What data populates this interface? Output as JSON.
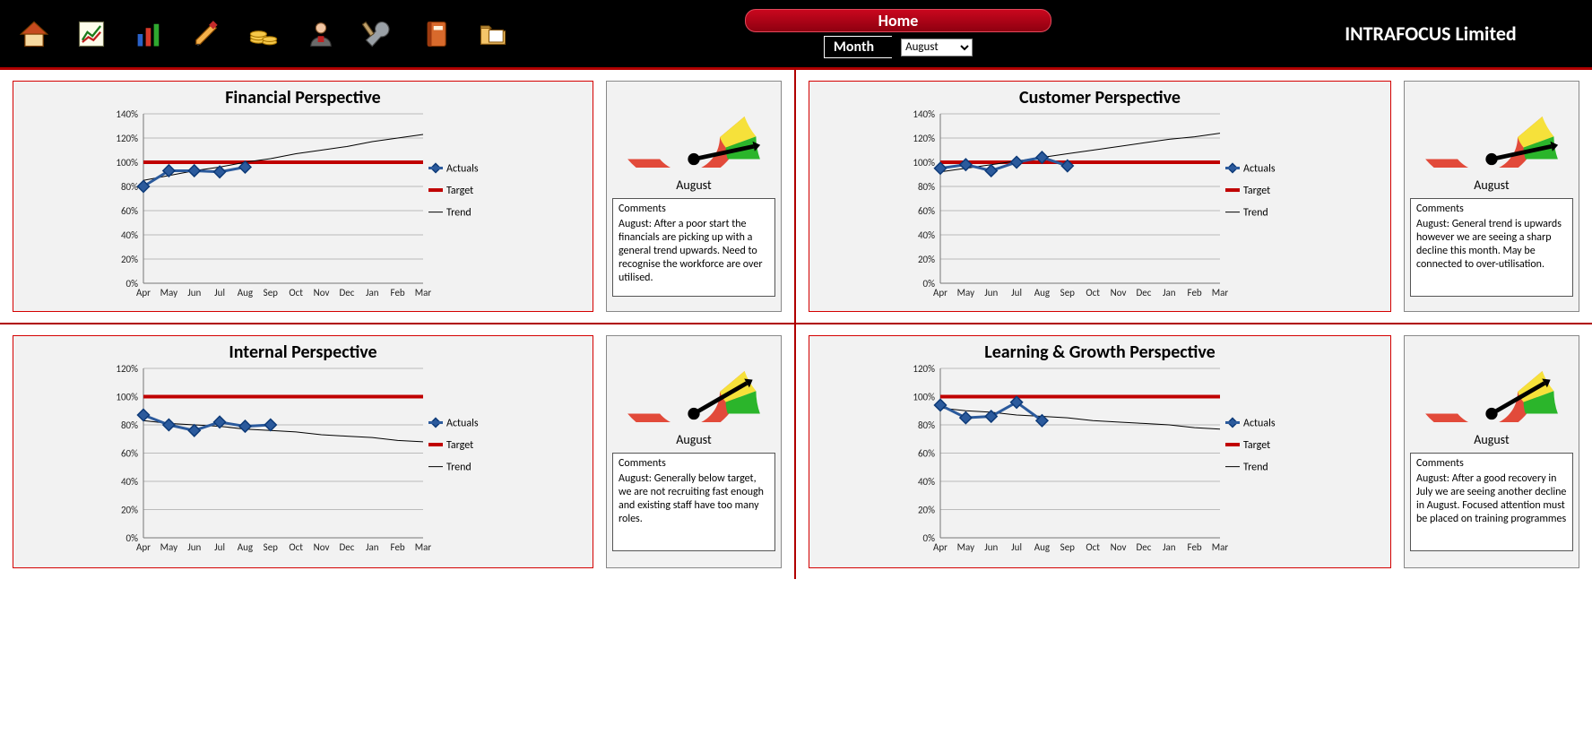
{
  "brand": "INTRAFOCUS Limited",
  "home_label": "Home",
  "month_label": "Month",
  "month_selected": "August",
  "comments_heading": "Comments",
  "legend": {
    "actuals": "Actuals",
    "target": "Target",
    "trend": "Trend"
  },
  "toolbar_icons": [
    "home",
    "report",
    "bar-chart",
    "edit",
    "finance",
    "user",
    "tools",
    "notebook",
    "folder"
  ],
  "panels": [
    {
      "id": "financial",
      "title": "Financial Perspective",
      "gauge_month": "August",
      "gauge_zone": "green",
      "comment": "August: After a poor start the financials are picking up with a general trend upwards.  Need to recognise the workforce are over utilised."
    },
    {
      "id": "customer",
      "title": "Customer Perspective",
      "gauge_month": "August",
      "gauge_zone": "green",
      "comment": "August: General trend is upwards however we are seeing a sharp decline this month.  May be connected to over-utilisation."
    },
    {
      "id": "internal",
      "title": "Internal Perspective",
      "gauge_month": "August",
      "gauge_zone": "yellow",
      "comment": "August: Generally below target, we are not recruiting fast enough and existing staff have too many roles."
    },
    {
      "id": "learning",
      "title": "Learning & Growth Perspective",
      "gauge_month": "August",
      "gauge_zone": "yellow",
      "comment": "August: After a good recovery in July we are seeing another decline in August.  Focused attention must be placed on training programmes"
    }
  ],
  "chart_data": [
    {
      "panel": "financial",
      "type": "line",
      "title": "Financial Perspective",
      "ylabel": "",
      "xlabel": "",
      "categories": [
        "Apr",
        "May",
        "Jun",
        "Jul",
        "Aug",
        "Sep",
        "Oct",
        "Nov",
        "Dec",
        "Jan",
        "Feb",
        "Mar"
      ],
      "ylim": [
        0,
        140
      ],
      "yticks": [
        0,
        20,
        40,
        60,
        80,
        100,
        120,
        140
      ],
      "tick_suffix": "%",
      "series": [
        {
          "name": "Actuals",
          "values": [
            80,
            93,
            93,
            92,
            96,
            null,
            null,
            null,
            null,
            null,
            null,
            null
          ]
        },
        {
          "name": "Target",
          "values": [
            100,
            100,
            100,
            100,
            100,
            100,
            100,
            100,
            100,
            100,
            100,
            100
          ]
        },
        {
          "name": "Trend",
          "values": [
            85,
            89,
            93,
            96,
            100,
            103,
            107,
            110,
            113,
            117,
            120,
            123
          ]
        }
      ]
    },
    {
      "panel": "customer",
      "type": "line",
      "title": "Customer Perspective",
      "ylabel": "",
      "xlabel": "",
      "categories": [
        "Apr",
        "May",
        "Jun",
        "Jul",
        "Aug",
        "Sep",
        "Oct",
        "Nov",
        "Dec",
        "Jan",
        "Feb",
        "Mar"
      ],
      "ylim": [
        0,
        140
      ],
      "yticks": [
        0,
        20,
        40,
        60,
        80,
        100,
        120,
        140
      ],
      "tick_suffix": "%",
      "series": [
        {
          "name": "Actuals",
          "values": [
            95,
            98,
            93,
            100,
            104,
            97,
            null,
            null,
            null,
            null,
            null,
            null
          ]
        },
        {
          "name": "Target",
          "values": [
            100,
            100,
            100,
            100,
            100,
            100,
            100,
            100,
            100,
            100,
            100,
            100
          ]
        },
        {
          "name": "Trend",
          "values": [
            92,
            95,
            98,
            101,
            104,
            107,
            110,
            113,
            116,
            119,
            121,
            124
          ]
        }
      ]
    },
    {
      "panel": "internal",
      "type": "line",
      "title": "Internal Perspective",
      "ylabel": "",
      "xlabel": "",
      "categories": [
        "Apr",
        "May",
        "Jun",
        "Jul",
        "Aug",
        "Sep",
        "Oct",
        "Nov",
        "Dec",
        "Jan",
        "Feb",
        "Mar"
      ],
      "ylim": [
        0,
        120
      ],
      "yticks": [
        0,
        20,
        40,
        60,
        80,
        100,
        120
      ],
      "tick_suffix": "%",
      "series": [
        {
          "name": "Actuals",
          "values": [
            87,
            80,
            76,
            82,
            79,
            80,
            null,
            null,
            null,
            null,
            null,
            null
          ]
        },
        {
          "name": "Target",
          "values": [
            100,
            100,
            100,
            100,
            100,
            100,
            100,
            100,
            100,
            100,
            100,
            100
          ]
        },
        {
          "name": "Trend",
          "values": [
            83,
            81,
            80,
            79,
            77,
            76,
            75,
            73,
            72,
            71,
            69,
            68
          ]
        }
      ]
    },
    {
      "panel": "learning",
      "type": "line",
      "title": "Learning & Growth Perspective",
      "ylabel": "",
      "xlabel": "",
      "categories": [
        "Apr",
        "May",
        "Jun",
        "Jul",
        "Aug",
        "Sep",
        "Oct",
        "Nov",
        "Dec",
        "Jan",
        "Feb",
        "Mar"
      ],
      "ylim": [
        0,
        120
      ],
      "yticks": [
        0,
        20,
        40,
        60,
        80,
        100,
        120
      ],
      "tick_suffix": "%",
      "series": [
        {
          "name": "Actuals",
          "values": [
            94,
            85,
            86,
            96,
            83,
            null,
            null,
            null,
            null,
            null,
            null,
            null
          ]
        },
        {
          "name": "Target",
          "values": [
            100,
            100,
            100,
            100,
            100,
            100,
            100,
            100,
            100,
            100,
            100,
            100
          ]
        },
        {
          "name": "Trend",
          "values": [
            92,
            90,
            89,
            87,
            86,
            85,
            83,
            82,
            81,
            80,
            78,
            77
          ]
        }
      ]
    }
  ]
}
